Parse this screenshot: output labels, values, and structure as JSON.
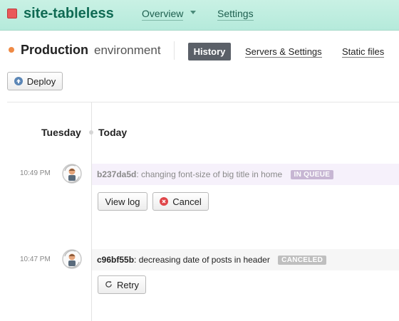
{
  "app": {
    "name": "site-tableless",
    "nav": {
      "overview": "Overview",
      "settings": "Settings"
    }
  },
  "environment": {
    "name": "Production",
    "suffix": "environment",
    "tabs": {
      "history": "History",
      "servers": "Servers & Settings",
      "static": "Static files"
    }
  },
  "actions": {
    "deploy": "Deploy"
  },
  "timeline": {
    "day": "Tuesday",
    "relative": "Today",
    "deploys": [
      {
        "time": "10:49 PM",
        "hash": "b237da5d",
        "message": ": changing font-size of big title in home",
        "status": "IN QUEUE",
        "buttons": {
          "view_log": "View log",
          "cancel": "Cancel"
        }
      },
      {
        "time": "10:47 PM",
        "hash": "c96bf55b",
        "message": ": decreasing date of posts in header",
        "status": "CANCELED",
        "buttons": {
          "retry": "Retry"
        }
      }
    ]
  },
  "colors": {
    "topbar": "#b5eadb",
    "brand": "#0f6a53",
    "env_dot": "#ef8a45",
    "history_tab": "#5b6068",
    "queue_badge": "#c7b6d3",
    "canceled_badge": "#bfbfbf",
    "cancel_icon": "#e0464a",
    "deploy_icon": "#5b86b6"
  },
  "icons": {
    "app": "square-app-icon",
    "caret": "caret-down-icon",
    "deploy": "arrow-up-circle-icon",
    "cancel": "close-circle-icon",
    "retry": "refresh-icon",
    "avatar": "user-avatar-icon"
  }
}
